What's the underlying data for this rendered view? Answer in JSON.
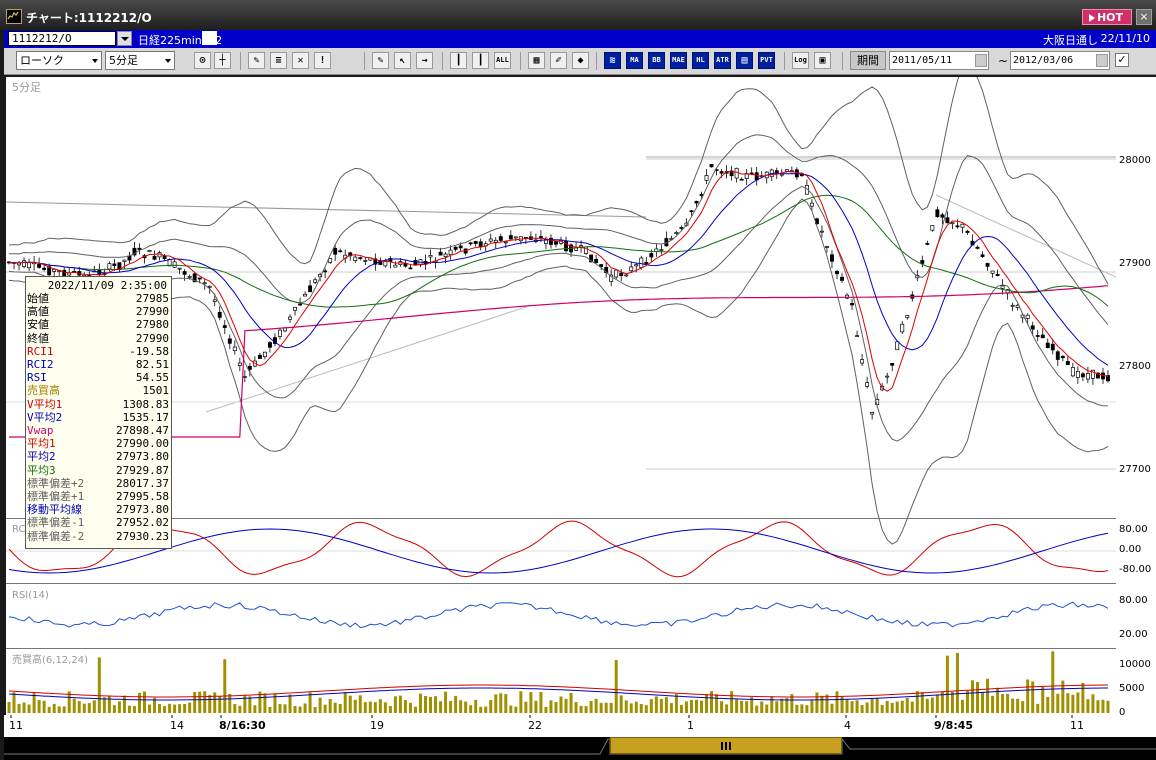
{
  "window": {
    "title": "チャート:1112212/O",
    "hot_label": "HOT",
    "close_label": "×"
  },
  "symbol_bar": {
    "code": "1112212/O",
    "name": "日経225mini 12",
    "market": "大阪日通し",
    "date": "22/11/10"
  },
  "toolbar": {
    "chart_type": "ローソク",
    "interval": "5分足",
    "period_label": "期間",
    "date_from": "2011/05/11",
    "date_to": "2012/03/06",
    "range_separator": "~",
    "icon_buttons": [
      {
        "name": "zoom-icon",
        "text": ""
      },
      {
        "name": "crosshair-icon",
        "text": ""
      },
      {
        "name": "draw-icon",
        "text": ""
      },
      {
        "name": "fibo-icon",
        "text": ""
      },
      {
        "name": "delete-line-icon",
        "text": ""
      },
      {
        "name": "alert-icon",
        "text": ""
      },
      {
        "name": "pen-icon",
        "text": ""
      },
      {
        "name": "cursor-icon",
        "text": ""
      },
      {
        "name": "arrow-icon",
        "text": ""
      },
      {
        "name": "candle-icon",
        "text": ""
      },
      {
        "name": "candle2-icon",
        "text": ""
      },
      {
        "name": "all-button",
        "text": "ALL"
      },
      {
        "name": "grid-icon",
        "text": ""
      },
      {
        "name": "brush-icon",
        "text": ""
      },
      {
        "name": "palette-icon",
        "text": ""
      },
      {
        "name": "indicator-1",
        "text": ""
      },
      {
        "name": "ma-button",
        "text": "MA"
      },
      {
        "name": "bb-button",
        "text": "BB"
      },
      {
        "name": "mae-button",
        "text": "MAE"
      },
      {
        "name": "hl-button",
        "text": "HL"
      },
      {
        "name": "atr-button",
        "text": "ATR"
      },
      {
        "name": "ichimoku-button",
        "text": ""
      },
      {
        "name": "pvt-button",
        "text": "PVT"
      },
      {
        "name": "log-button",
        "text": "Log"
      },
      {
        "name": "export-icon",
        "text": ""
      }
    ]
  },
  "chart": {
    "price_panel_label": "5分足",
    "rci_label": "RC",
    "rsi_label": "RSI(14)",
    "volume_label": "売買高(6,12,24)",
    "price_ticks": [
      "28000",
      "27900",
      "27800",
      "27700"
    ],
    "rci_ticks": [
      "80.00",
      "0.00",
      "-80.00"
    ],
    "rsi_ticks": [
      "80.00",
      "20.00"
    ],
    "volume_ticks": [
      "10000",
      "5000",
      "0"
    ],
    "x_labels": [
      "11",
      "14",
      "8/16:30",
      "19",
      "22",
      "1",
      "4",
      "9/8:45",
      "11"
    ],
    "colors": {
      "up": "#000000",
      "down": "#000000",
      "ma1": "#e00000",
      "ma2": "#0000c8",
      "ma3": "#107010",
      "vwap": "#d0006a",
      "bb": "#606060",
      "volume": "#a09000"
    }
  },
  "info_box": {
    "datetime": "2022/11/09 2:35:00",
    "rows": [
      {
        "key": "始値",
        "value": "27985",
        "color": "#000000"
      },
      {
        "key": "高値",
        "value": "27990",
        "color": "#000000"
      },
      {
        "key": "安値",
        "value": "27980",
        "color": "#000000"
      },
      {
        "key": "終値",
        "value": "27990",
        "color": "#000000"
      },
      {
        "key": "RCI1",
        "value": "-19.58",
        "color": "#d00000"
      },
      {
        "key": "RCI2",
        "value": "82.51",
        "color": "#0000c0"
      },
      {
        "key": "RSI",
        "value": "54.55",
        "color": "#0000c0"
      },
      {
        "key": "売買高",
        "value": "1501",
        "color": "#a08000"
      },
      {
        "key": "V平均1",
        "value": "1308.83",
        "color": "#d00000"
      },
      {
        "key": "V平均2",
        "value": "1535.17",
        "color": "#0000c0"
      },
      {
        "key": "Vwap",
        "value": "27898.47",
        "color": "#d0006a"
      },
      {
        "key": "平均1",
        "value": "27990.00",
        "color": "#d00000"
      },
      {
        "key": "平均2",
        "value": "27973.80",
        "color": "#0000c0"
      },
      {
        "key": "平均3",
        "value": "27929.87",
        "color": "#107010"
      },
      {
        "key": "標準偏差+2",
        "value": "28017.37",
        "color": "#606060"
      },
      {
        "key": "標準偏差+1",
        "value": "27995.58",
        "color": "#606060"
      },
      {
        "key": "移動平均線",
        "value": "27973.80",
        "color": "#0000c0"
      },
      {
        "key": "標準偏差-1",
        "value": "27952.02",
        "color": "#606060"
      },
      {
        "key": "標準偏差-2",
        "value": "27930.23",
        "color": "#606060"
      }
    ]
  }
}
